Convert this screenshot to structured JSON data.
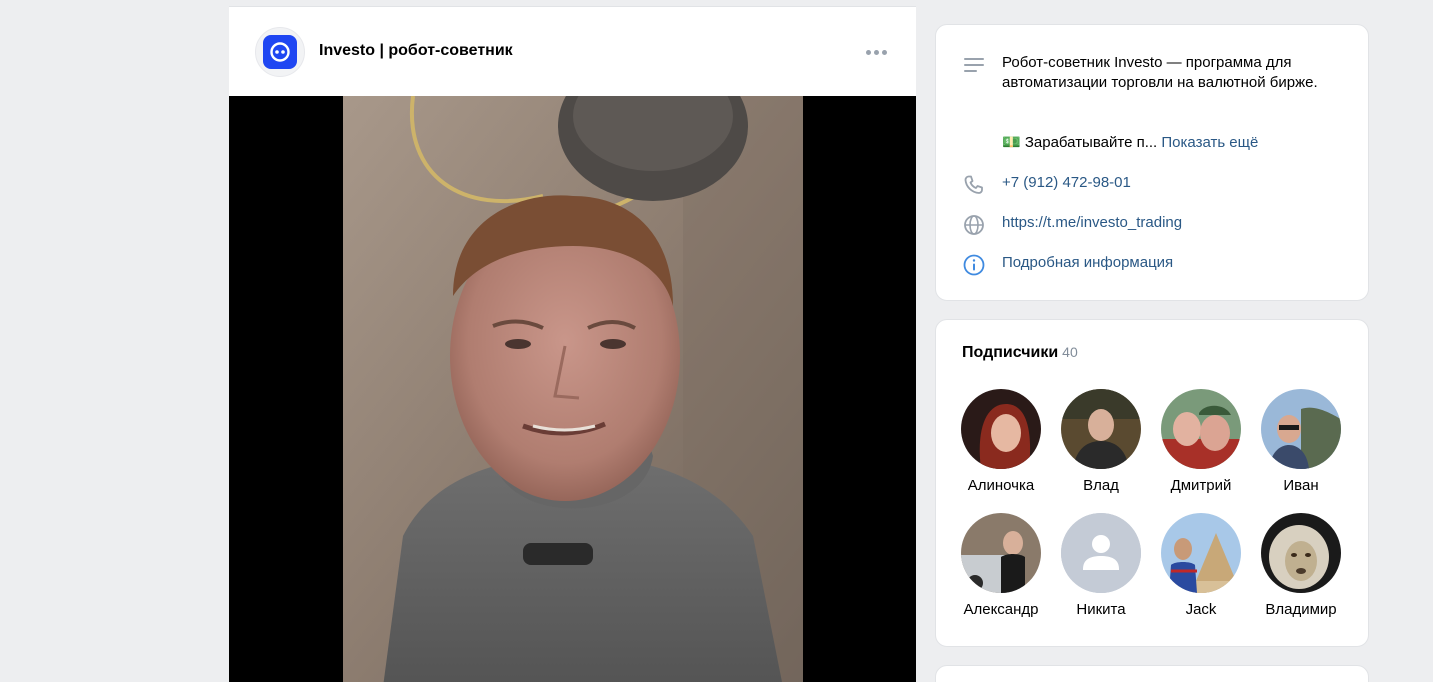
{
  "post": {
    "title": "Investo | робот-советник"
  },
  "info": {
    "description": "Робот-советник Investo — программа для автоматизации торговли на валютной бирже.",
    "teaser": "💵 Зарабатывайте п...",
    "show_more": "Показать ещё",
    "phone": "+7 (912) 472-98-01",
    "website": "https://t.me/investo_trading",
    "details": "Подробная информация"
  },
  "subscribers": {
    "title": "Подписчики",
    "count": "40",
    "people": [
      {
        "name": "Алиночка"
      },
      {
        "name": "Влад"
      },
      {
        "name": "Дмитрий"
      },
      {
        "name": "Иван"
      },
      {
        "name": "Александр"
      },
      {
        "name": "Никита"
      },
      {
        "name": "Jack"
      },
      {
        "name": "Владимир"
      }
    ]
  }
}
